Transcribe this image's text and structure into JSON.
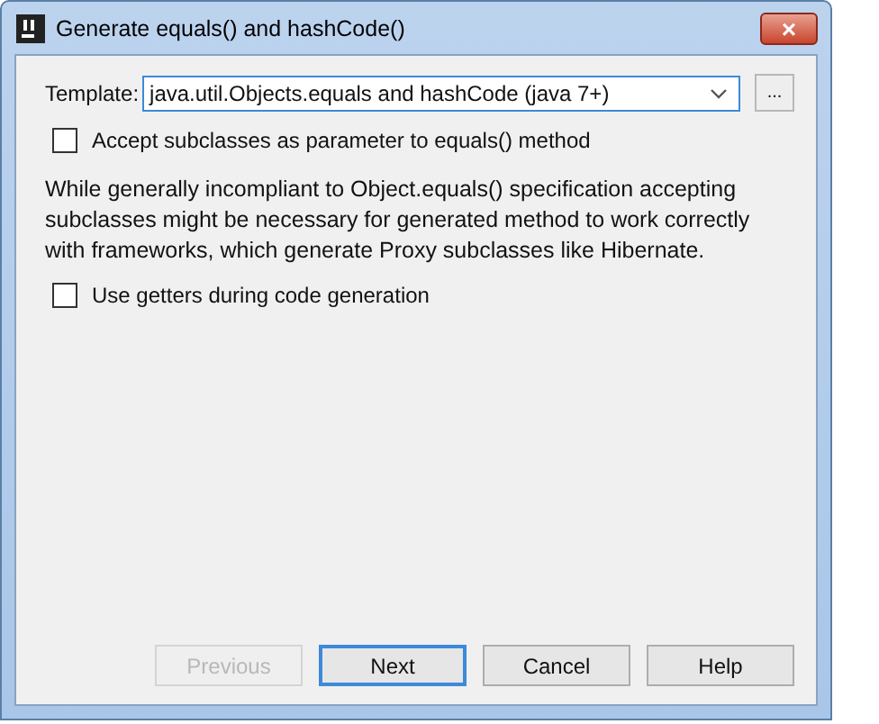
{
  "window": {
    "title": "Generate equals() and hashCode()",
    "close": "×"
  },
  "template": {
    "label": "Template:",
    "value": "java.util.Objects.equals and hashCode (java 7+)",
    "more": "..."
  },
  "options": [
    {
      "label": "Accept subclasses as parameter to equals() method",
      "checked": false,
      "note": "While generally incompliant to Object.equals() specification accepting subclasses might be necessary for generated method to work correctly with frameworks, which generate Proxy subclasses like Hibernate."
    },
    {
      "label": "Use getters during code generation",
      "checked": false
    }
  ],
  "buttons": [
    {
      "label": "Previous",
      "disabled": true,
      "default": false
    },
    {
      "label": "Next",
      "disabled": false,
      "default": true
    },
    {
      "label": "Cancel",
      "disabled": false,
      "default": false
    },
    {
      "label": "Help",
      "disabled": false,
      "default": false
    }
  ]
}
